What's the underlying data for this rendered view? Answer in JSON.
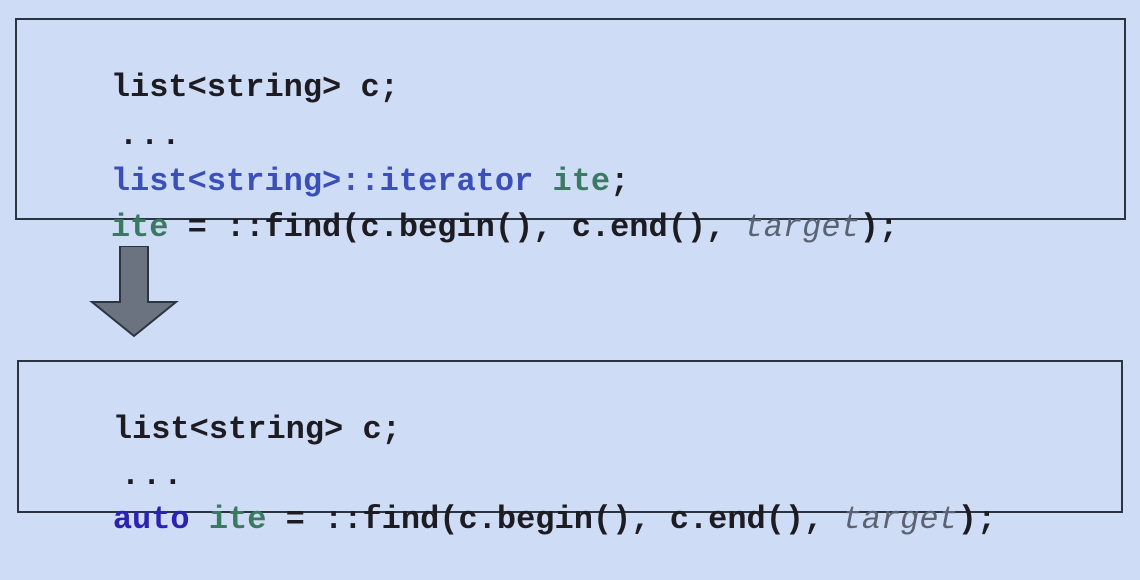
{
  "colors": {
    "background": "#cfdcf6",
    "box_border": "#2c3440",
    "plain_text": "#1c1c22",
    "type_blue": "#3a4fb8",
    "keyword_blue": "#2a22b0",
    "variable_green": "#3a7a62",
    "param_gray": "#5b6272",
    "arrow_fill": "#6b7280"
  },
  "before": {
    "lines": [
      [
        {
          "t": "list<string> c;",
          "k": "plain"
        }
      ],
      [
        {
          "t": "...",
          "k": "plain"
        }
      ],
      [
        {
          "t": "list<string>::iterator",
          "k": "type"
        },
        {
          "t": " ",
          "k": "plain"
        },
        {
          "t": "ite",
          "k": "var"
        },
        {
          "t": ";",
          "k": "plain"
        }
      ],
      [
        {
          "t": "ite",
          "k": "var"
        },
        {
          "t": " = ::find(c.begin(), c.end(), ",
          "k": "plain"
        },
        {
          "t": "target",
          "k": "param"
        },
        {
          "t": ");",
          "k": "plain"
        }
      ]
    ]
  },
  "arrow_icon": "arrow-down-icon",
  "after": {
    "lines": [
      [
        {
          "t": "list<string> c;",
          "k": "plain"
        }
      ],
      [
        {
          "t": "...",
          "k": "plain"
        }
      ],
      [
        {
          "t": "auto",
          "k": "kw"
        },
        {
          "t": " ",
          "k": "plain"
        },
        {
          "t": "ite",
          "k": "var"
        },
        {
          "t": " = ::find(c.begin(), c.end(), ",
          "k": "plain"
        },
        {
          "t": "target",
          "k": "param"
        },
        {
          "t": ");",
          "k": "plain"
        }
      ]
    ]
  }
}
